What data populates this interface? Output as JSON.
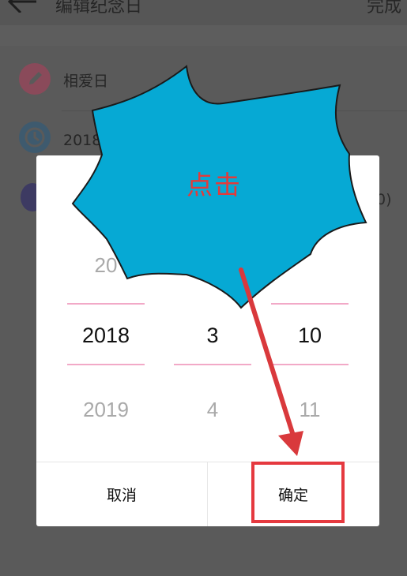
{
  "topbar": {
    "title": "编辑纪念日",
    "done_label": "完成"
  },
  "form": {
    "name_row": {
      "icon": "pencil-icon",
      "value": "相爱日"
    },
    "date_row": {
      "icon": "clock-icon",
      "value": "2018年"
    },
    "third_row": {
      "icon": "person-icon",
      "suffix": "0)"
    }
  },
  "picker": {
    "years": {
      "above": "20",
      "selected": "2018",
      "below": "2019"
    },
    "months": {
      "selected": "3",
      "below": "4"
    },
    "days": {
      "selected": "10",
      "below": "11"
    }
  },
  "dialog": {
    "cancel_label": "取消",
    "confirm_label": "确定"
  },
  "annotation": {
    "callout_text": "点击"
  },
  "colors": {
    "accent_pink": "#f2a9c7",
    "annotation_red": "#e5393f",
    "burst_blue": "#06a9d4"
  }
}
